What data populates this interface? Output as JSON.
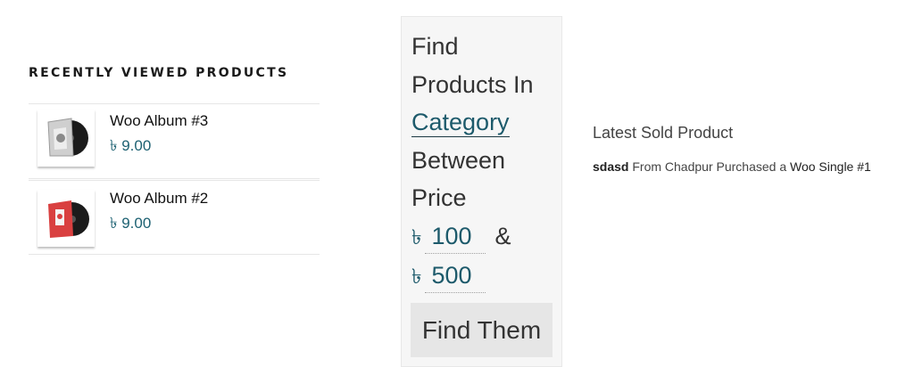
{
  "recently_viewed": {
    "title": "RECENTLY VIEWED PRODUCTS",
    "items": [
      {
        "name": "Woo Album #3",
        "price": "৳ 9.00",
        "cover_color": "#cfcfcf"
      },
      {
        "name": "Woo Album #2",
        "price": "৳ 9.00",
        "cover_color": "#d94040"
      }
    ]
  },
  "find_products": {
    "line1": "Find",
    "line2": "Products In",
    "category": "Category",
    "line4": "Between",
    "line5": "Price",
    "currency": "৳",
    "min_price": "100",
    "amp": "&",
    "max_price": "500",
    "button": "Find Them"
  },
  "latest_sold": {
    "title": "Latest Sold Product",
    "user": "sdasd",
    "text_from": " From Chadpur Purchased a ",
    "product": "Woo Single #1"
  },
  "colors": {
    "link": "#1d6172",
    "widget_bg": "#f6f6f6",
    "button_bg": "#e6e6e6"
  }
}
